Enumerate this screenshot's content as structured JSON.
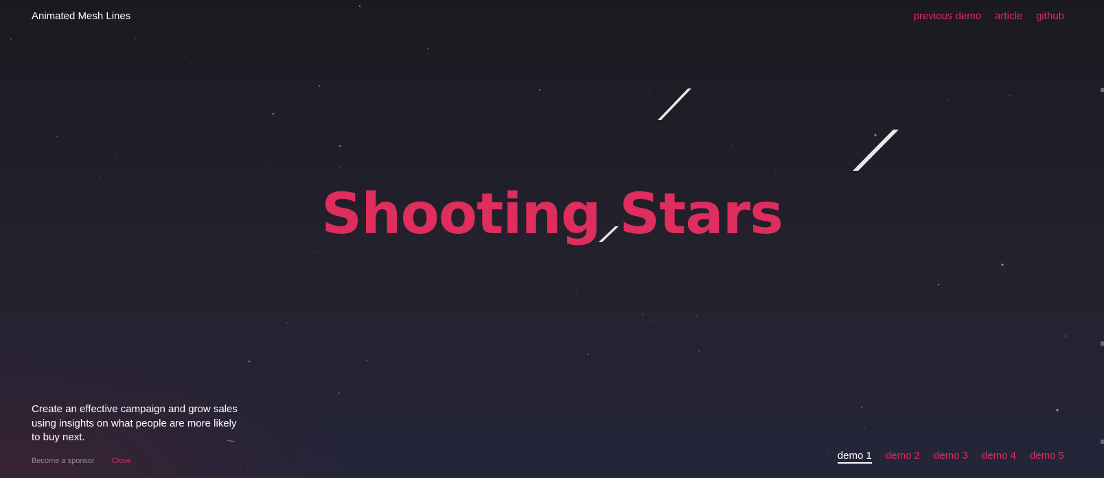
{
  "header": {
    "site_title": "Animated Mesh Lines",
    "nav": [
      {
        "label": "previous demo"
      },
      {
        "label": "article"
      },
      {
        "label": "github"
      }
    ]
  },
  "hero": {
    "title": "Shooting Stars"
  },
  "sponsor": {
    "text": "Create an effective campaign and grow sales using insights on what people are more likely to buy next.",
    "become_label": "Become a sponsor",
    "close_label": "Close"
  },
  "demos": {
    "items": [
      {
        "label": "demo 1",
        "active": true
      },
      {
        "label": "demo 2",
        "active": false
      },
      {
        "label": "demo 3",
        "active": false
      },
      {
        "label": "demo 4",
        "active": false
      },
      {
        "label": "demo 5",
        "active": false
      }
    ]
  },
  "colors": {
    "accent": "#df2d5e",
    "background": "#201f29",
    "star": "#8a8a94",
    "shooting_star": "#e8e8ee"
  }
}
